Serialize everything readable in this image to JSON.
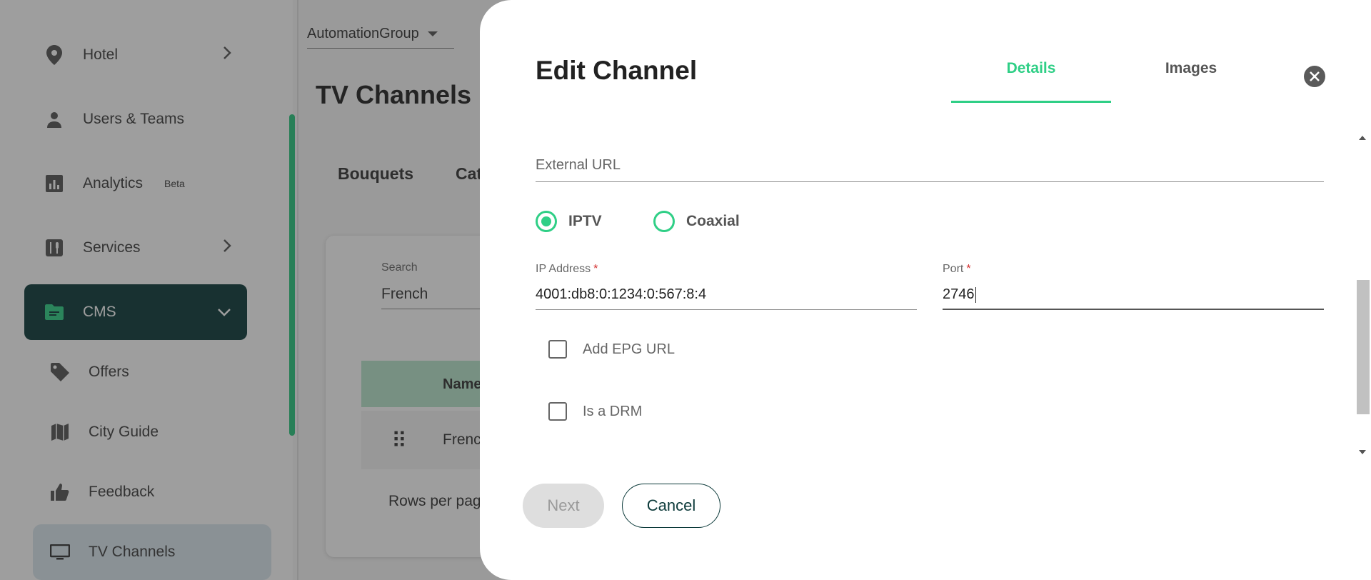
{
  "sidebar": {
    "items": [
      {
        "label": "Hotel",
        "icon": "location-pin-icon"
      },
      {
        "label": "Users & Teams",
        "icon": "person-icon"
      },
      {
        "label": "Analytics",
        "icon": "analytics-icon",
        "badge": "Beta"
      },
      {
        "label": "Services",
        "icon": "restaurant-icon"
      },
      {
        "label": "CMS",
        "icon": "folder-icon"
      }
    ],
    "subitems": [
      {
        "label": "Offers",
        "icon": "tag-icon"
      },
      {
        "label": "City Guide",
        "icon": "map-icon"
      },
      {
        "label": "Feedback",
        "icon": "thumbs-up-icon"
      },
      {
        "label": "TV Channels",
        "icon": "tv-icon"
      }
    ]
  },
  "header": {
    "group": "AutomationGroup"
  },
  "page": {
    "title": "TV Channels"
  },
  "bg_tabs": [
    "Bouquets",
    "Cat"
  ],
  "bg_search": {
    "label": "Search",
    "value": "French"
  },
  "bg_table": {
    "header": "Name",
    "row": "Frenc",
    "rows_per_page": "Rows per pag"
  },
  "modal": {
    "title": "Edit Channel",
    "tabs": [
      "Details",
      "Images"
    ],
    "external_url_placeholder": "External URL",
    "stream_type": {
      "options": [
        "IPTV",
        "Coaxial"
      ],
      "selected": "IPTV"
    },
    "ip_address": {
      "label": "IP Address",
      "required": "*",
      "value": "4001:db8:0:1234:0:567:8:4"
    },
    "port": {
      "label": "Port",
      "required": "*",
      "value": "2746"
    },
    "checkboxes": [
      {
        "label": "Add EPG URL",
        "checked": false
      },
      {
        "label": "Is a DRM",
        "checked": false
      }
    ],
    "next_label": "Next",
    "cancel_label": "Cancel"
  },
  "colors": {
    "accent": "#2fcf86",
    "dark": "#0c3a3a",
    "required": "#d32f2f"
  }
}
